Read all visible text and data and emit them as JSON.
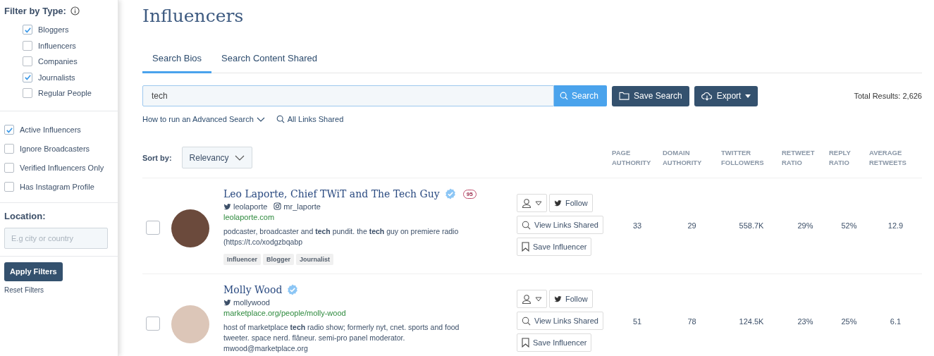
{
  "sidebar": {
    "type_filter": {
      "title": "Filter by Type:",
      "options": [
        {
          "label": "Bloggers",
          "checked": true
        },
        {
          "label": "Influencers",
          "checked": false
        },
        {
          "label": "Companies",
          "checked": false
        },
        {
          "label": "Journalists",
          "checked": true
        },
        {
          "label": "Regular People",
          "checked": false
        }
      ]
    },
    "flags": [
      {
        "label": "Active Influencers",
        "checked": true
      },
      {
        "label": "Ignore Broadcasters",
        "checked": false
      },
      {
        "label": "Verified Influencers Only",
        "checked": false
      },
      {
        "label": "Has Instagram Profile",
        "checked": false
      }
    ],
    "location": {
      "label": "Location:",
      "placeholder": "E.g city or country"
    },
    "apply_button": "Apply Filters",
    "reset_link": "Reset Filters"
  },
  "page_title": "Influencers",
  "tabs": [
    {
      "label": "Search Bios",
      "selected": true
    },
    {
      "label": "Search Content Shared",
      "selected": false
    }
  ],
  "search": {
    "value": "tech",
    "button": "Search",
    "save_button": "Save Search",
    "export_button": "Export",
    "total": "Total Results: 2,626"
  },
  "links": {
    "advanced_search": "How to run an Advanced Search",
    "all_links": "All Links Shared"
  },
  "sort": {
    "label": "Sort by:",
    "value": "Relevancy"
  },
  "columns": [
    "PAGE AUTHORITY",
    "DOMAIN AUTHORITY",
    "TWITTER FOLLOWERS",
    "RETWEET RATIO",
    "REPLY RATIO",
    "AVERAGE RETWEETS"
  ],
  "rows": [
    {
      "checked": false,
      "name": "Leo Laporte, Chief TWiT and The Tech Guy",
      "verified": true,
      "score": "95",
      "twitter": "leolaporte",
      "instagram": "mr_laporte",
      "website": "leolaporte.com",
      "bio": "podcaster, broadcaster and **tech** pundit. the **tech** guy on premiere radio (https://t.co/xodgzbqabp",
      "tags": [
        "Influencer",
        "Blogger",
        "Journalist"
      ],
      "follow": "Follow",
      "view_links": "View Links Shared",
      "save": "Save Influencer",
      "stats": [
        "33",
        "29",
        "558.7K",
        "29%",
        "52%",
        "12.9"
      ]
    },
    {
      "checked": false,
      "name": "Molly Wood",
      "verified": true,
      "twitter": "mollywood",
      "website": "marketplace.org/people/molly-wood",
      "bio": "host of marketplace **tech** radio show; formerly nyt, cnet. sports and food tweeter. space nerd. flâneur. semi-pro panel moderator. mwood@marketplace.org",
      "follow": "Follow",
      "view_links": "View Links Shared",
      "save": "Save Influencer",
      "stats": [
        "51",
        "78",
        "124.5K",
        "23%",
        "25%",
        "6.1"
      ]
    }
  ]
}
